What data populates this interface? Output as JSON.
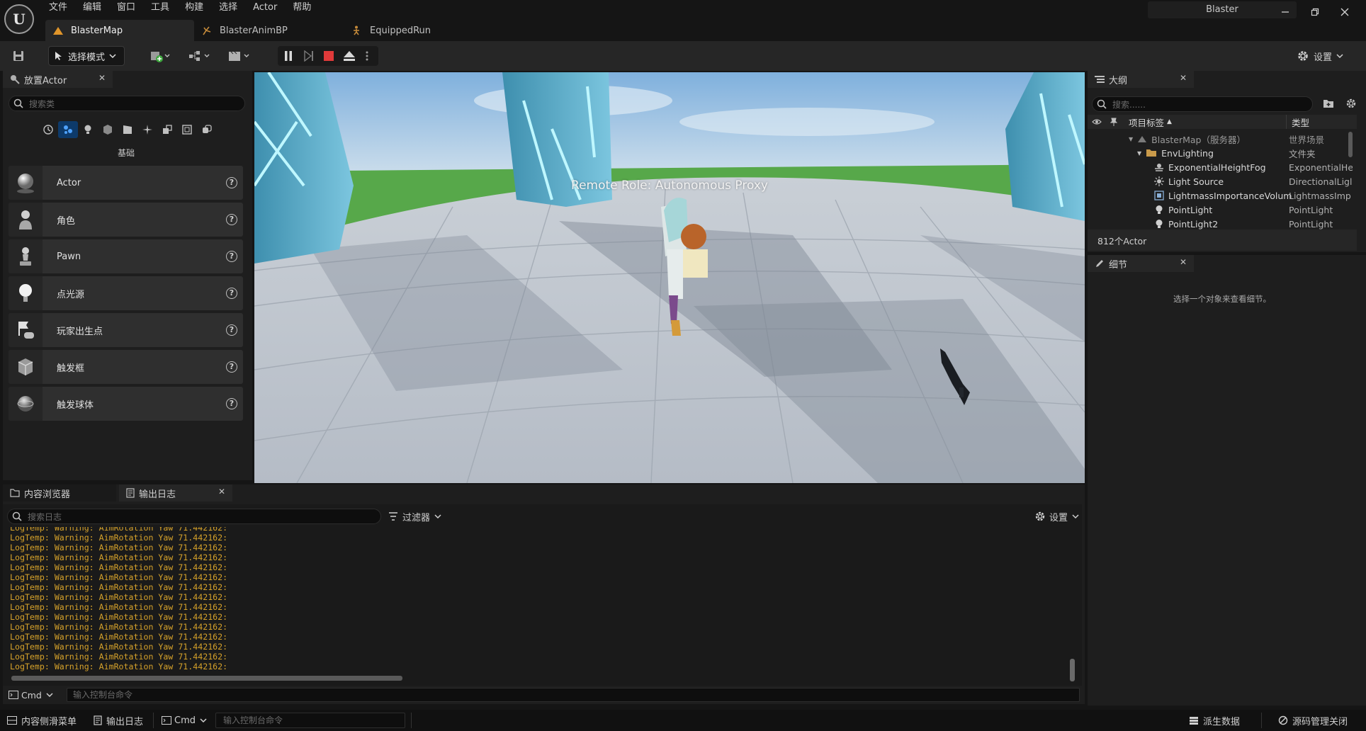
{
  "app": {
    "logo": "U",
    "project_name": "Blaster",
    "menu": [
      "文件",
      "编辑",
      "窗口",
      "工具",
      "构建",
      "选择",
      "Actor",
      "帮助"
    ],
    "window_controls": [
      "minimize-icon",
      "restore-icon",
      "close-icon"
    ]
  },
  "doc_tabs": [
    {
      "label": "BlasterMap",
      "icon": "level-icon",
      "active": true
    },
    {
      "label": "BlasterAnimBP",
      "icon": "anim-blueprint-icon",
      "active": false
    },
    {
      "label": "EquippedRun",
      "icon": "animation-icon",
      "active": false
    }
  ],
  "toolbar": {
    "mode_label": "选择模式",
    "settings_label": "设置"
  },
  "place_actors": {
    "tab_label": "放置Actor",
    "search_placeholder": "搜索类",
    "category_label": "基础",
    "items": [
      {
        "label": "Actor",
        "icon": "sphere-icon"
      },
      {
        "label": "角色",
        "icon": "character-icon"
      },
      {
        "label": "Pawn",
        "icon": "pawn-icon"
      },
      {
        "label": "点光源",
        "icon": "point-light-icon"
      },
      {
        "label": "玩家出生点",
        "icon": "player-start-icon"
      },
      {
        "label": "触发框",
        "icon": "trigger-box-icon"
      },
      {
        "label": "触发球体",
        "icon": "trigger-sphere-icon"
      }
    ]
  },
  "viewport": {
    "overlay_text": "Remote Role: Autonomous Proxy"
  },
  "outliner": {
    "tab_label": "大纲",
    "search_placeholder": "搜索......",
    "col_label": "项目标签",
    "col_type": "类型",
    "rows": [
      {
        "label": "BlasterMap（服务器）",
        "type": "世界场景",
        "indent": 0,
        "icon": "world-icon"
      },
      {
        "label": "EnvLighting",
        "type": "文件夹",
        "indent": 1,
        "icon": "folder-icon"
      },
      {
        "label": "ExponentialHeightFog",
        "type": "ExponentialHe",
        "indent": 2,
        "icon": "fog-icon"
      },
      {
        "label": "Light Source",
        "type": "DirectionalLigl",
        "indent": 2,
        "icon": "sun-icon"
      },
      {
        "label": "LightmassImportanceVolum",
        "type": "LightmassImp",
        "indent": 2,
        "icon": "volume-icon"
      },
      {
        "label": "PointLight",
        "type": "PointLight",
        "indent": 2,
        "icon": "bulb-icon"
      },
      {
        "label": "PointLight2",
        "type": "PointLight",
        "indent": 2,
        "icon": "bulb-icon"
      }
    ],
    "actor_count": "812个Actor"
  },
  "details": {
    "tab_label": "细节",
    "empty_text": "选择一个对象来查看细节。"
  },
  "bottom": {
    "tabs": [
      "内容浏览器",
      "输出日志"
    ],
    "search_placeholder": "搜索日志",
    "filter_label": "过滤器",
    "settings_label": "设置",
    "log_lines": [
      "LogTemp: Warning: AimRotation Yaw 71.442162:",
      "LogTemp: Warning: AimRotation Yaw 71.442162:",
      "LogTemp: Warning: AimRotation Yaw 71.442162:",
      "LogTemp: Warning: AimRotation Yaw 71.442162:",
      "LogTemp: Warning: AimRotation Yaw 71.442162:",
      "LogTemp: Warning: AimRotation Yaw 71.442162:",
      "LogTemp: Warning: AimRotation Yaw 71.442162:",
      "LogTemp: Warning: AimRotation Yaw 71.442162:",
      "LogTemp: Warning: AimRotation Yaw 71.442162:",
      "LogTemp: Warning: AimRotation Yaw 71.442162:",
      "LogTemp: Warning: AimRotation Yaw 71.442162:",
      "LogTemp: Warning: AimRotation Yaw 71.442162:",
      "LogTemp: Warning: AimRotation Yaw 71.442162:",
      "LogTemp: Warning: AimRotation Yaw 71.442162:",
      "LogTemp: Warning: AimRotation Yaw 71.442162:"
    ],
    "cmd_label": "Cmd",
    "cmd_placeholder": "输入控制台命令"
  },
  "statusbar": {
    "content_drawer": "内容侧滑菜单",
    "output_log": "输出日志",
    "cmd_label": "Cmd",
    "cmd_placeholder": "输入控制台命令",
    "derived_data": "派生数据",
    "source_control": "源码管理关闭"
  },
  "colors": {
    "log_warning": "#d6a22a",
    "accent_blue": "#1e6bd6",
    "stop_red": "#e03a3a"
  }
}
